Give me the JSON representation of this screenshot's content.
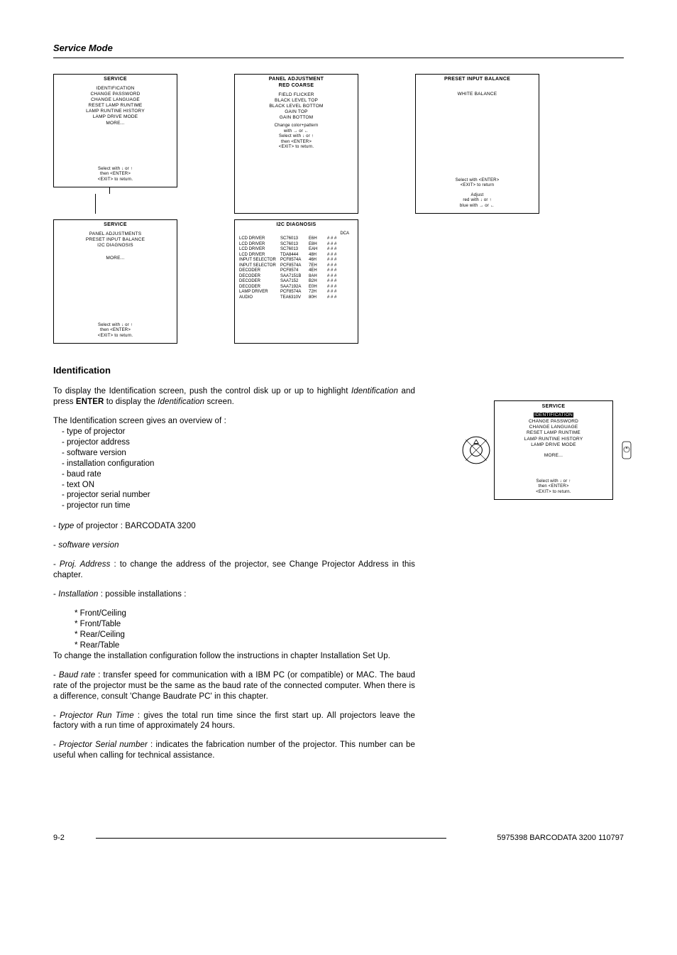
{
  "page": {
    "title": "Service Mode",
    "heading": "Identification"
  },
  "menus": {
    "service1": {
      "title": "SERVICE",
      "items": [
        "IDENTIFICATION",
        "CHANGE PASSWORD",
        "CHANGE LANGUAGE",
        "RESET LAMP RUNTIME",
        "LAMP RUNTINE HISTORY",
        "LAMP DRIVE MODE"
      ],
      "more": "MORE...",
      "instr1": "Select with  ↓  or ↑",
      "instr2": "then  <ENTER>",
      "instr3": "<EXIT>  to  return."
    },
    "panel": {
      "title1": "PANEL ADJUSTMENT",
      "title2": "RED COARSE",
      "items": [
        "FIELD FLICKER",
        "BLACK LEVEL TOP",
        "BLACK LEVEL BOTTOM",
        "GAIN TOP",
        "GAIN BOTTOM"
      ],
      "instr1": "Change color+pattern",
      "instr2": "with → or ←",
      "instr3": "Select with  ↓  or ↑",
      "instr4": "then  <ENTER>",
      "instr5": "<EXIT>  to  return."
    },
    "preset": {
      "title": "PRESET INPUT BALANCE",
      "item1": "WHITE  BALANCE",
      "instr1": "Select  with  <ENTER>",
      "instr2": "<EXIT>  to return",
      "instr3": "Adjust",
      "instr4": "red with ↓ or ↑",
      "instr5": "blue with  → or ←"
    },
    "service2": {
      "title": "SERVICE",
      "items": [
        "PANEL ADJUSTMENTS",
        "PRESET INPUT BALANCE",
        "I2C DIAGNOSIS"
      ],
      "more": "MORE...",
      "instr1": "Select with  ↓  or ↑",
      "instr2": "then  <ENTER>",
      "instr3": "<EXIT>  to  return."
    },
    "i2c": {
      "title": "I2C DIAGNOSIS",
      "header": "DCA",
      "rows": [
        [
          "LCD DRIVER",
          "SC76013",
          "E6H",
          "# # #"
        ],
        [
          "LCD DRIVER",
          "SC76013",
          "E8H",
          "# # #"
        ],
        [
          "LCD DRIVER",
          "SC76013",
          "EAH",
          "# # #"
        ],
        [
          "LCD DRIVER",
          "TDA8444",
          "48H",
          "# # #"
        ],
        [
          "INPUT SELECTOR",
          "PCF8574A",
          "46H",
          "# # #"
        ],
        [
          "INPUT SELECTOR",
          "PCF8574A",
          "7EH",
          "# # #"
        ],
        [
          "DECODER",
          "PCF8574",
          "4EH",
          "# # #"
        ],
        [
          "DECODER",
          "SAA7151B",
          "8AH",
          "# # #"
        ],
        [
          "DECODER",
          "SAA7152",
          "B2H",
          "# # #"
        ],
        [
          "DECODER",
          "SAA7192A",
          "E0H",
          "# # #"
        ],
        [
          "LAMP DRIVER",
          "PCF8574A",
          "72H",
          "# # #"
        ],
        [
          "AUDIO",
          "TEA6310V",
          "80H",
          "# # #"
        ]
      ]
    },
    "side": {
      "title": "SERVICE",
      "hi": "IDENTIFICATION",
      "items": [
        "CHANGE PASSWORD",
        "CHANGE LANGUAGE",
        "RESET LAMP RUNTIME",
        "LAMP RUNTINE HISTORY",
        "LAMP DRIVE MODE"
      ],
      "more": "MORE...",
      "instr1": "Select with  ↓  or ↑",
      "instr2": "then  <ENTER>",
      "instr3": "<EXIT>  to  return."
    }
  },
  "body": {
    "p1a": "To display the Identification screen, push the control disk up or up to highlight ",
    "p1b": "Identification",
    "p1c": " and press ",
    "p1d": "ENTER",
    "p1e": " to display the ",
    "p1f": "Identification",
    "p1g": " screen.",
    "p2": "The Identification screen gives an overview of :",
    "list1": [
      "- type of projector",
      " - projector address",
      "- software version",
      "- installation configuration",
      "- baud rate",
      "- text ON",
      "- projector serial number",
      "- projector run time"
    ],
    "p3a": "- ",
    "p3b": "type",
    "p3c": " of projector : BARCODATA 3200",
    "p4a": "- ",
    "p4b": "software version",
    "p5a": "- ",
    "p5b": "Proj. Address",
    "p5c": " : to change the address of the projector, see Change Projector Address in this chapter.",
    "p6a": "- ",
    "p6b": "Installation",
    "p6c": " : possible installations :",
    "list2": [
      "Front/Ceiling",
      "Front/Table",
      "Rear/Ceiling",
      "Rear/Table"
    ],
    "p7": "To change the installation configuration follow the instructions in chapter Installation Set Up.",
    "p8a": "- ",
    "p8b": "Baud rate",
    "p8c": " : transfer speed for communication with a IBM PC (or compatible) or MAC.  The baud rate of the projector must be the same as the baud rate of the connected computer. When there is a difference, consult 'Change Baudrate PC' in this chapter.",
    "p9a": "- ",
    "p9b": "Projector Run Time",
    "p9c": " : gives the total run time since the first start up. All projectors leave the factory with a run time of approximately 24 hours.",
    "p10a": "- ",
    "p10b": "Projector Serial number",
    "p10c": " : indicates the fabrication number of the projector.  This number can be useful when calling for technical assistance."
  },
  "footer": {
    "left": "9-2",
    "right": "5975398 BARCODATA 3200 110797"
  }
}
